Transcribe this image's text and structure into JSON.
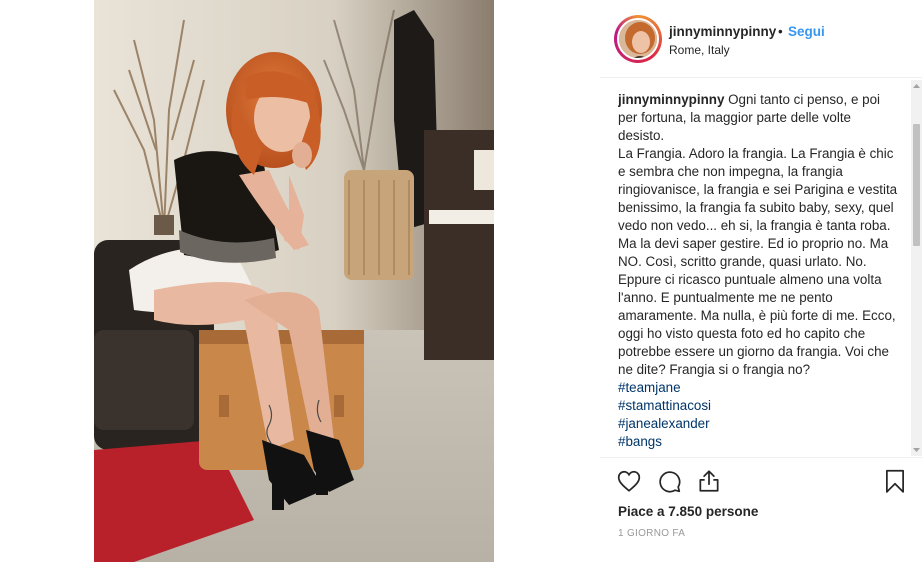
{
  "post": {
    "username": "jinnyminnypinny",
    "separator": "•",
    "follow_label": "Segui",
    "location": "Rome, Italy"
  },
  "caption": {
    "username": "jinnyminnypinny",
    "paragraph1": "Ogni tanto ci penso, e poi per fortuna, la maggior parte delle volte desisto.",
    "paragraph2": "La Frangia. Adoro la frangia. La Frangia è chic e sembra che non impegna, la frangia ringiovanisce, la frangia e sei Parigina e vestita benissimo, la frangia fa subito baby, sexy, quel vedo non vedo... eh si, la frangia è tanta roba. Ma la devi saper gestire. Ed io proprio no. Ma NO. Così, scritto grande, quasi urlato. No. Eppure ci ricasco puntuale almeno una volta l'anno. E puntualmente me ne pento amaramente. Ma nulla, è più forte di me. Ecco, oggi ho visto questa foto ed ho capito che potrebbe essere un giorno da frangia. Voi che ne dite? Frangia si o frangia no?",
    "hashtags": [
      "#teamjane",
      "#stamattinacosi",
      "#janealexander",
      "#bangs"
    ]
  },
  "actions": {
    "like_icon": "heart-icon",
    "comment_icon": "comment-icon",
    "share_icon": "share-icon",
    "save_icon": "bookmark-icon"
  },
  "likes_text": "Piace a 7.850 persone",
  "time_text": "1 GIORNO FA",
  "colors": {
    "link_blue": "#3897f0",
    "hashtag_blue": "#003569",
    "text": "#262626",
    "muted": "#999999",
    "divider": "#efefef"
  }
}
